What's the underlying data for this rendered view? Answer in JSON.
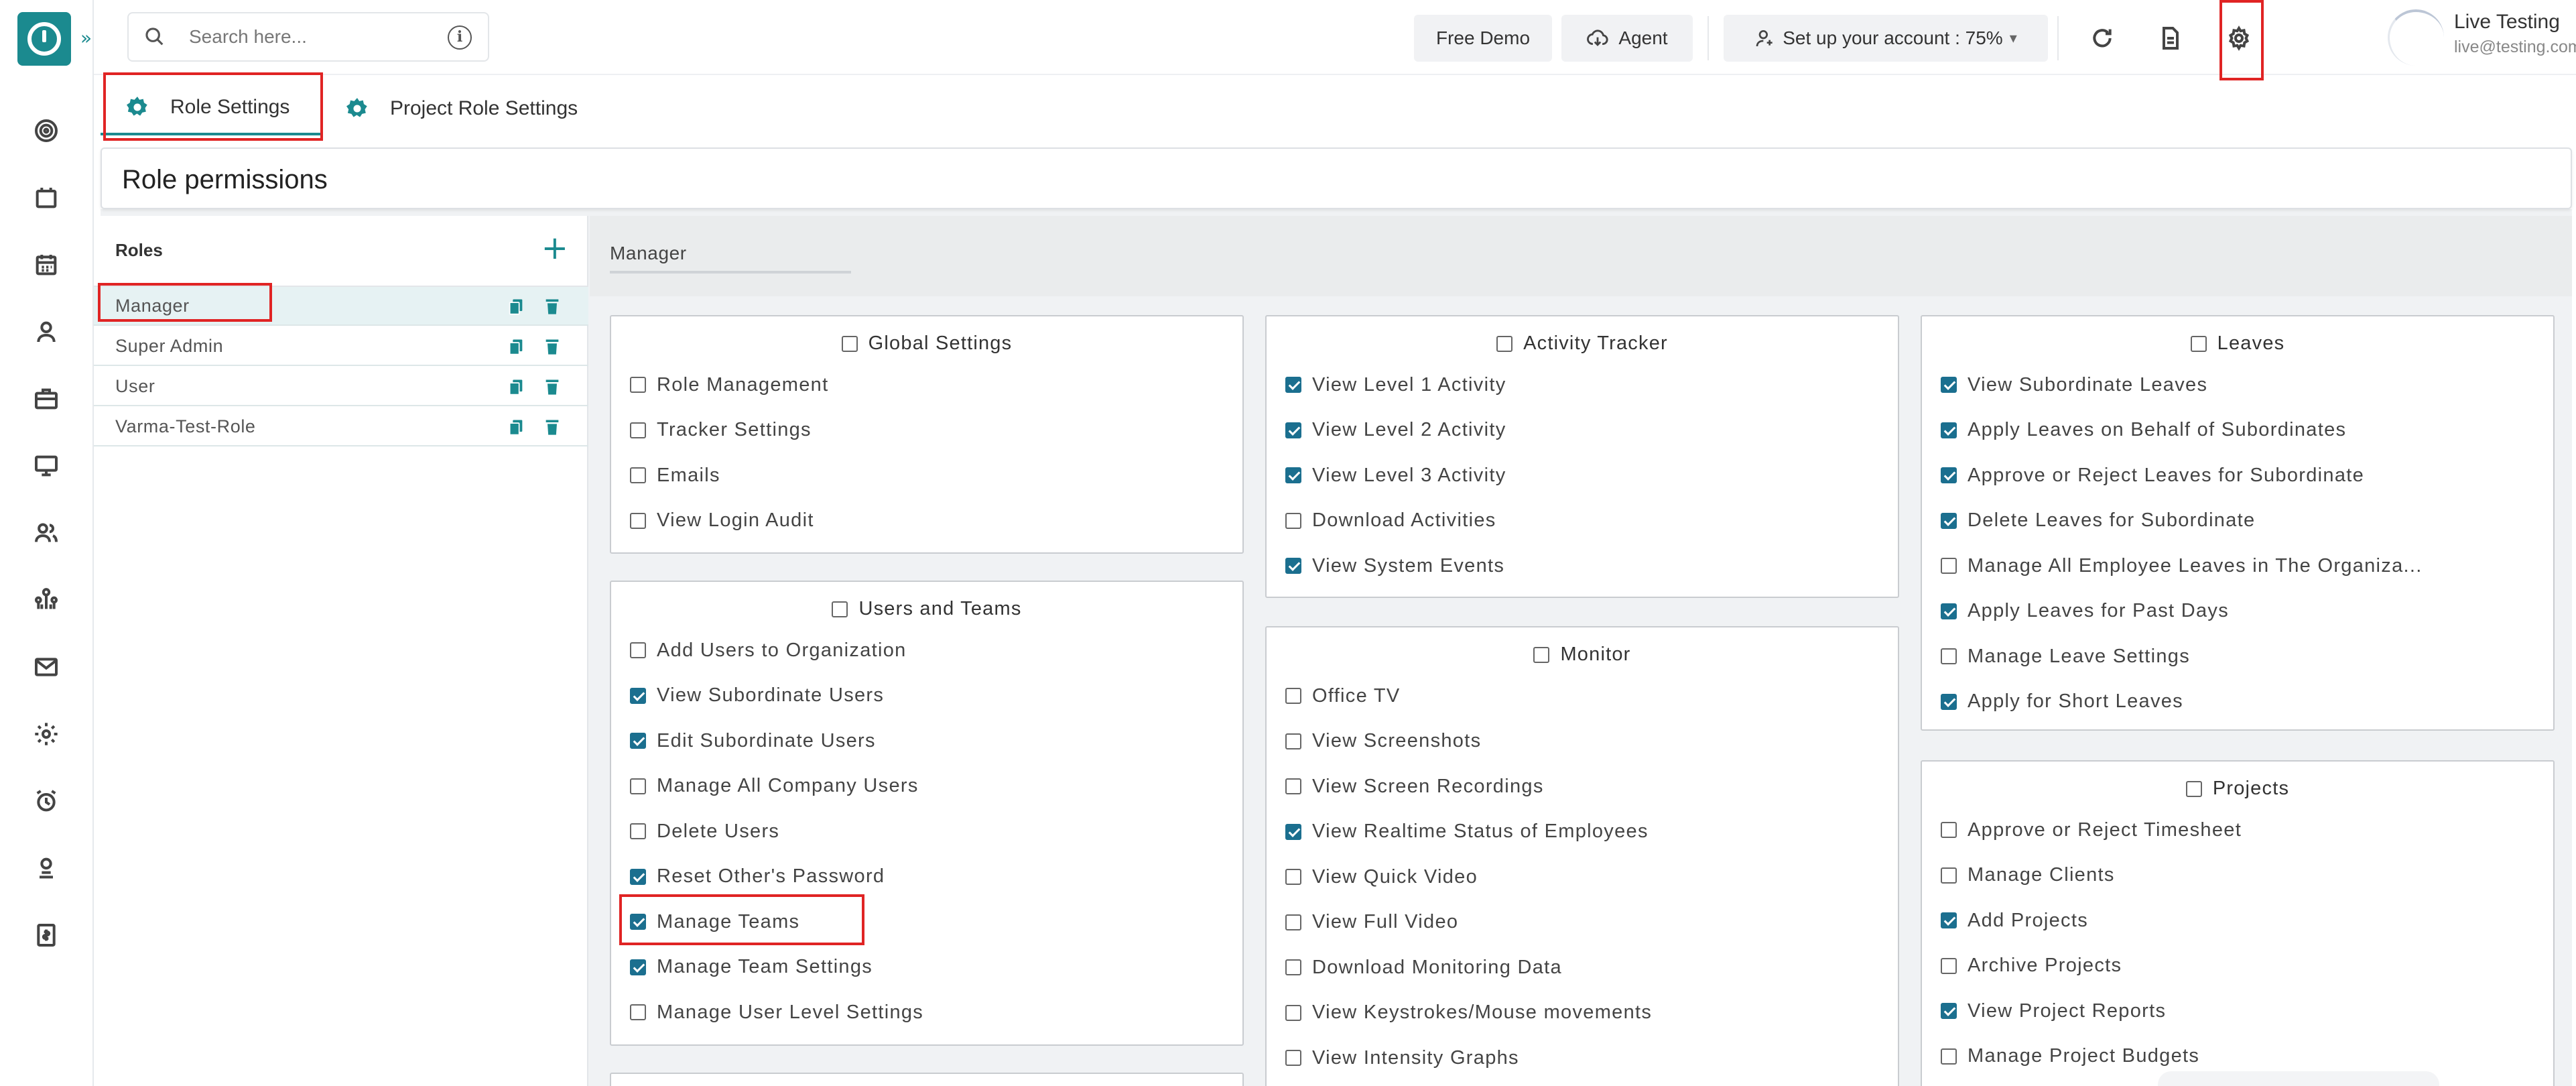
{
  "topbar": {
    "search_placeholder": "Search here...",
    "free_demo": "Free Demo",
    "agent": "Agent",
    "setup": "Set up your account : 75%",
    "setup_caret": "▾",
    "user_name": "Live Testing",
    "user_email": "live@testing.com"
  },
  "tabs": {
    "role_settings": "Role Settings",
    "project_role_settings": "Project Role Settings"
  },
  "page": {
    "title": "Role permissions"
  },
  "roles": {
    "title": "Roles",
    "add": "+",
    "items": [
      "Manager",
      "Super Admin",
      "User",
      "Varma-Test-Role"
    ]
  },
  "role_name_value": "Manager",
  "cards": {
    "global_settings": {
      "title": "Global Settings",
      "items": [
        {
          "label": "Role Management",
          "checked": false
        },
        {
          "label": "Tracker Settings",
          "checked": false
        },
        {
          "label": "Emails",
          "checked": false
        },
        {
          "label": "View Login Audit",
          "checked": false
        }
      ]
    },
    "users_and_teams": {
      "title": "Users and Teams",
      "items": [
        {
          "label": "Add Users to Organization",
          "checked": false
        },
        {
          "label": "View Subordinate Users",
          "checked": true
        },
        {
          "label": "Edit Subordinate Users",
          "checked": true
        },
        {
          "label": "Manage All Company Users",
          "checked": false
        },
        {
          "label": "Delete Users",
          "checked": false
        },
        {
          "label": "Reset Other's Password",
          "checked": true
        },
        {
          "label": "Manage Teams",
          "checked": true
        },
        {
          "label": "Manage Team Settings",
          "checked": true
        },
        {
          "label": "Manage User Level Settings",
          "checked": false
        }
      ]
    },
    "activity_tracker": {
      "title": "Activity Tracker",
      "items": [
        {
          "label": "View Level 1 Activity",
          "checked": true
        },
        {
          "label": "View Level 2 Activity",
          "checked": true
        },
        {
          "label": "View Level 3 Activity",
          "checked": true
        },
        {
          "label": "Download Activities",
          "checked": false
        },
        {
          "label": "View System Events",
          "checked": true
        }
      ]
    },
    "monitor": {
      "title": "Monitor",
      "items": [
        {
          "label": "Office TV",
          "checked": false
        },
        {
          "label": "View Screenshots",
          "checked": false
        },
        {
          "label": "View Screen Recordings",
          "checked": false
        },
        {
          "label": "View Realtime Status of Employees",
          "checked": true
        },
        {
          "label": "View Quick Video",
          "checked": false
        },
        {
          "label": "View Full Video",
          "checked": false
        },
        {
          "label": "Download Monitoring Data",
          "checked": false
        },
        {
          "label": "View Keystrokes/Mouse movements",
          "checked": false
        },
        {
          "label": "View Intensity Graphs",
          "checked": false
        }
      ]
    },
    "leaves": {
      "title": "Leaves",
      "items": [
        {
          "label": "View Subordinate Leaves",
          "checked": true
        },
        {
          "label": "Apply Leaves on Behalf of Subordinates",
          "checked": true
        },
        {
          "label": "Approve or Reject Leaves for Subordinate",
          "checked": true
        },
        {
          "label": "Delete Leaves for Subordinate",
          "checked": true
        },
        {
          "label": "Manage All Employee Leaves in The Organiza...",
          "checked": false
        },
        {
          "label": "Apply Leaves for Past Days",
          "checked": true
        },
        {
          "label": "Manage Leave Settings",
          "checked": false
        },
        {
          "label": "Apply for Short Leaves",
          "checked": true
        }
      ]
    },
    "projects": {
      "title": "Projects",
      "items": [
        {
          "label": "Approve or Reject Timesheet",
          "checked": false
        },
        {
          "label": "Manage Clients",
          "checked": false
        },
        {
          "label": "Add Projects",
          "checked": true
        },
        {
          "label": "Archive Projects",
          "checked": false
        },
        {
          "label": "View Project Reports",
          "checked": true
        },
        {
          "label": "Manage Project Budgets",
          "checked": false
        }
      ]
    }
  },
  "colors": {
    "accent": "#1b8a8f",
    "checkbox": "#1b6f8f",
    "highlight": "#e02424"
  }
}
